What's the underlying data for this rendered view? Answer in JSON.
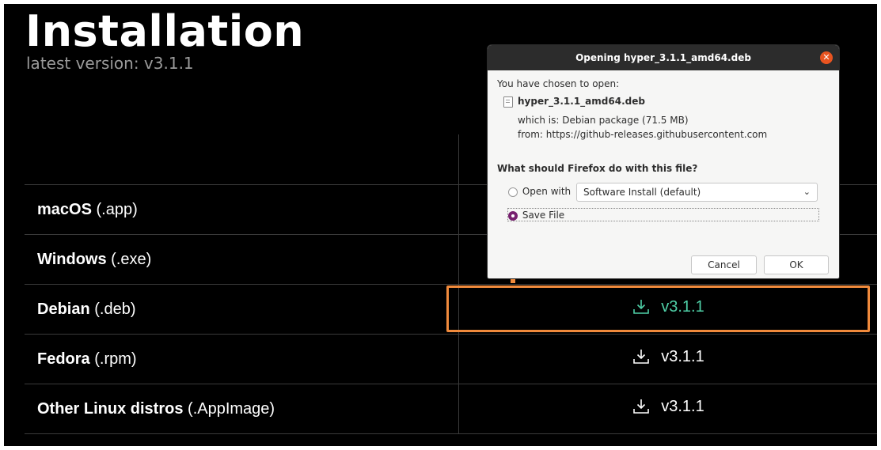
{
  "page": {
    "title": "Installation",
    "subtitle": "latest version: v3.1.1"
  },
  "downloads": [
    {
      "os": "macOS",
      "ext": "(.app)",
      "version": null
    },
    {
      "os": "Windows",
      "ext": "(.exe)",
      "version": null
    },
    {
      "os": "Debian",
      "ext": "(.deb)",
      "version": "v3.1.1"
    },
    {
      "os": "Fedora",
      "ext": "(.rpm)",
      "version": "v3.1.1"
    },
    {
      "os": "Other Linux distros",
      "ext": "(.AppImage)",
      "version": "v3.1.1"
    }
  ],
  "dialog": {
    "title": "Opening hyper_3.1.1_amd64.deb",
    "close_icon": "close-icon",
    "chosen_label": "You have chosen to open:",
    "filename": "hyper_3.1.1_amd64.deb",
    "which_is": "which is: Debian package (71.5 MB)",
    "from": "from: https://github-releases.githubusercontent.com",
    "question": "What should Firefox do with this file?",
    "open_with_label": "Open with",
    "open_with_app": "Software Install (default)",
    "save_file_label": "Save File",
    "selected_option": "save_file",
    "cancel_label": "Cancel",
    "ok_label": "OK"
  },
  "annotation": {
    "color": "#f08a3c",
    "highlight_target": "Debian download",
    "arrow_target": "Save File"
  },
  "colors": {
    "accent_link": "#4fd0a7",
    "ubuntu_orange": "#e95420",
    "radio_selected": "#77216f"
  }
}
